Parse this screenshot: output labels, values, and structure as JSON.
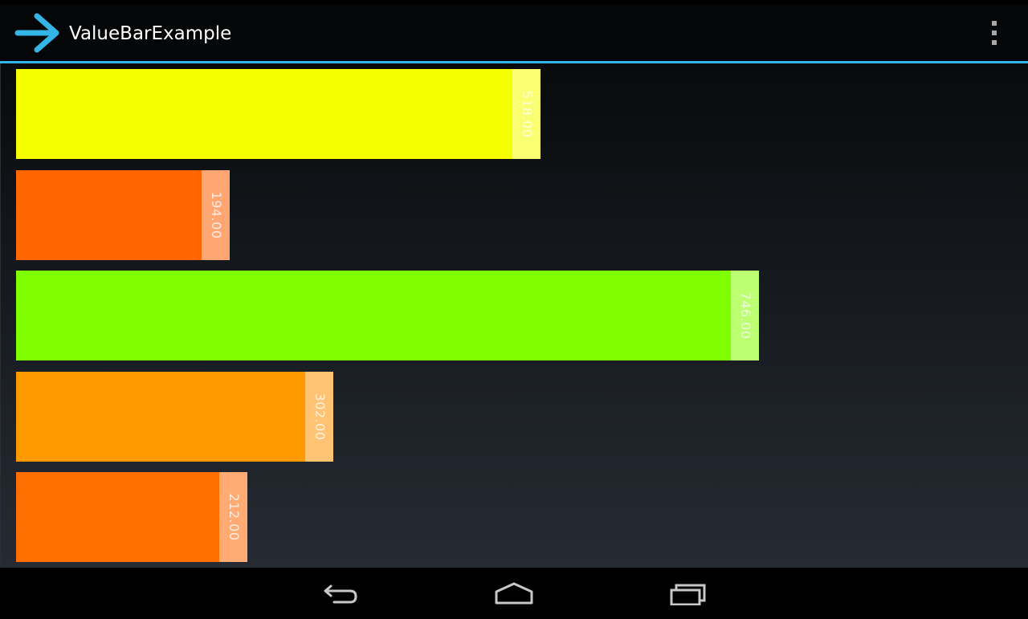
{
  "app": {
    "title": "ValueBarExample",
    "icon": "arrow-right-icon",
    "accent_color": "#33b5e5"
  },
  "action_bar": {
    "overflow_icon": "overflow-menu-icon"
  },
  "value_bars": [
    {
      "value": 518,
      "label": "518.00",
      "color": "#f5ff00",
      "cap_color": "#f9ff70"
    },
    {
      "value": 194,
      "label": "194.00",
      "color": "#ff6600",
      "cap_color": "#ffa673"
    },
    {
      "value": 746,
      "label": "746.00",
      "color": "#80ff00",
      "cap_color": "#bcff70"
    },
    {
      "value": 302,
      "label": "302.00",
      "color": "#ff9a00",
      "cap_color": "#ffc373"
    },
    {
      "value": 212,
      "label": "212.00",
      "color": "#ff6f00",
      "cap_color": "#ffab73"
    }
  ],
  "nav": {
    "back_icon": "back-icon",
    "home_icon": "home-icon",
    "recents_icon": "recent-apps-icon"
  }
}
